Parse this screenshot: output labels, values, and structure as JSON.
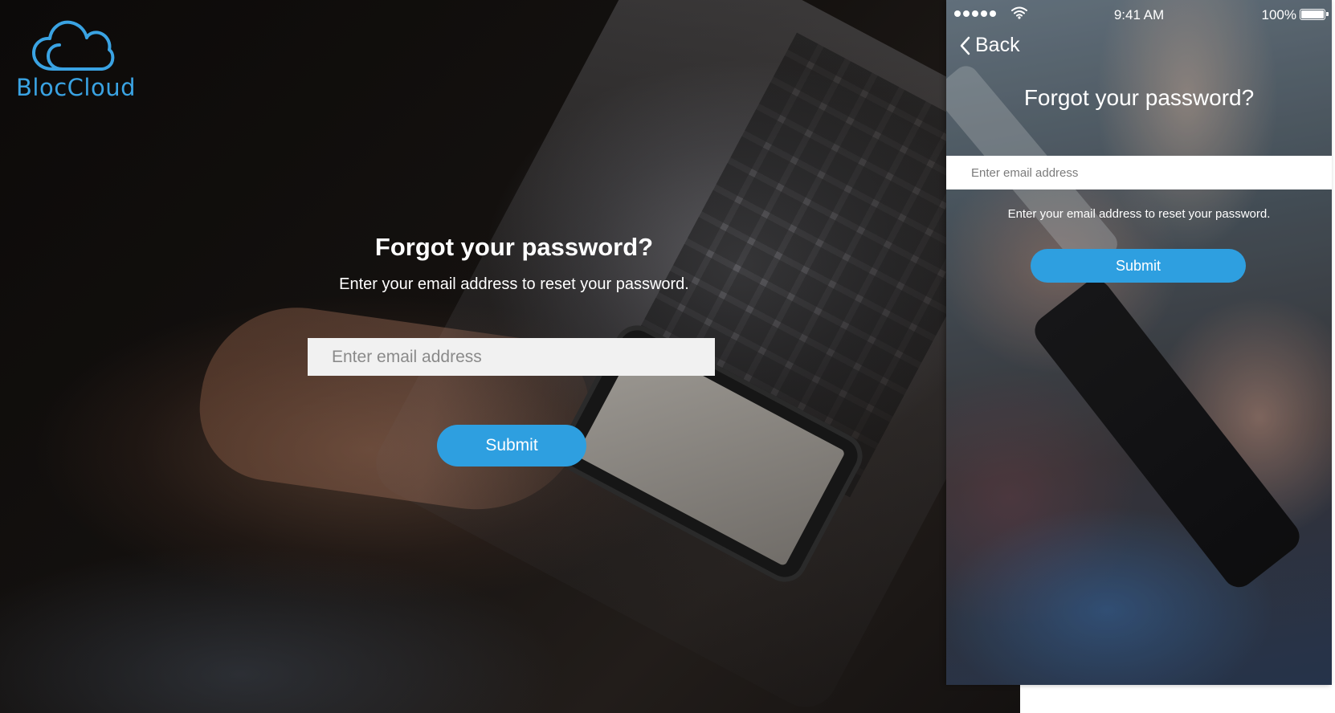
{
  "desktop": {
    "logo": {
      "text": "BlocCloud",
      "icon": "cloud-icon",
      "color": "#3aa3e3"
    },
    "title": "Forgot your password?",
    "subtitle": "Enter your email address to reset your password.",
    "email_input": {
      "placeholder": "Enter email address",
      "value": ""
    },
    "submit_label": "Submit"
  },
  "mobile": {
    "status_bar": {
      "signal_icon": "signal-dots-icon",
      "wifi_icon": "wifi-icon",
      "time": "9:41 AM",
      "battery_percent": "100%",
      "battery_icon": "battery-icon"
    },
    "back_label": "Back",
    "back_icon": "chevron-left-icon",
    "title": "Forgot your password?",
    "email_input": {
      "placeholder": "Enter email address",
      "value": ""
    },
    "helper_text": "Enter your email address to reset your password.",
    "submit_label": "Submit"
  },
  "colors": {
    "accent": "#2e9fe0",
    "logo": "#3aa3e3",
    "input_background_desktop": "#f1f1f1",
    "input_background_mobile": "#ffffff"
  }
}
